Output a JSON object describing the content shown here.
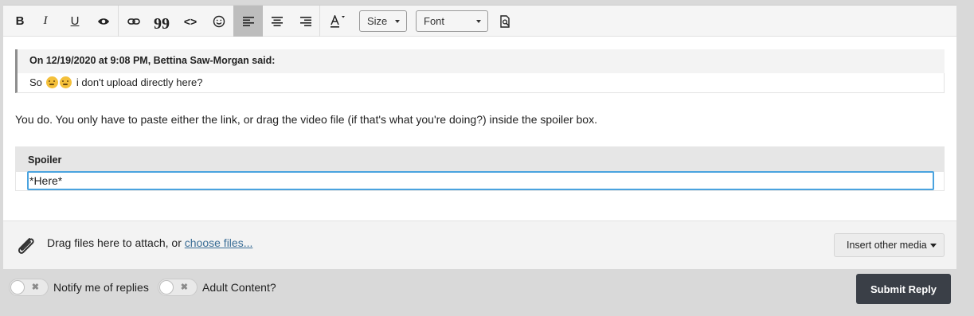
{
  "toolbar": {
    "bold": "B",
    "italic": "I",
    "underline": "U",
    "quote_glyph": "99",
    "code_glyph": "<>",
    "size_label": "Size",
    "font_label": "Font",
    "active_item": "align-left",
    "icons": [
      "bold-icon",
      "italic-icon",
      "underline-icon",
      "eye-icon",
      "link-icon",
      "quote-icon",
      "code-icon",
      "smiley-icon",
      "align-left-icon",
      "align-center-icon",
      "align-right-icon",
      "text-color-icon",
      "preview-icon"
    ]
  },
  "quote": {
    "header": "On 12/19/2020 at 9:08 PM, Bettina Saw-Morgan said:",
    "prefix": "So",
    "suffix": "i don't upload directly here?"
  },
  "body": {
    "paragraph": "You do. You only have to paste either the link, or drag the video file (if that's what you're doing?) inside the spoiler box."
  },
  "spoiler": {
    "title": "Spoiler",
    "value": "*Here*"
  },
  "attach": {
    "text": "Drag files here to attach, or ",
    "link": "choose files...",
    "media_button": "Insert other media"
  },
  "footer": {
    "notify_label": "Notify me of replies",
    "adult_label": "Adult Content?",
    "submit_label": "Submit Reply",
    "toggle_glyph": "✖"
  },
  "colors": {
    "accent": "#4aa3df",
    "submit_bg": "#3a3f47",
    "link": "#3b6e96"
  }
}
